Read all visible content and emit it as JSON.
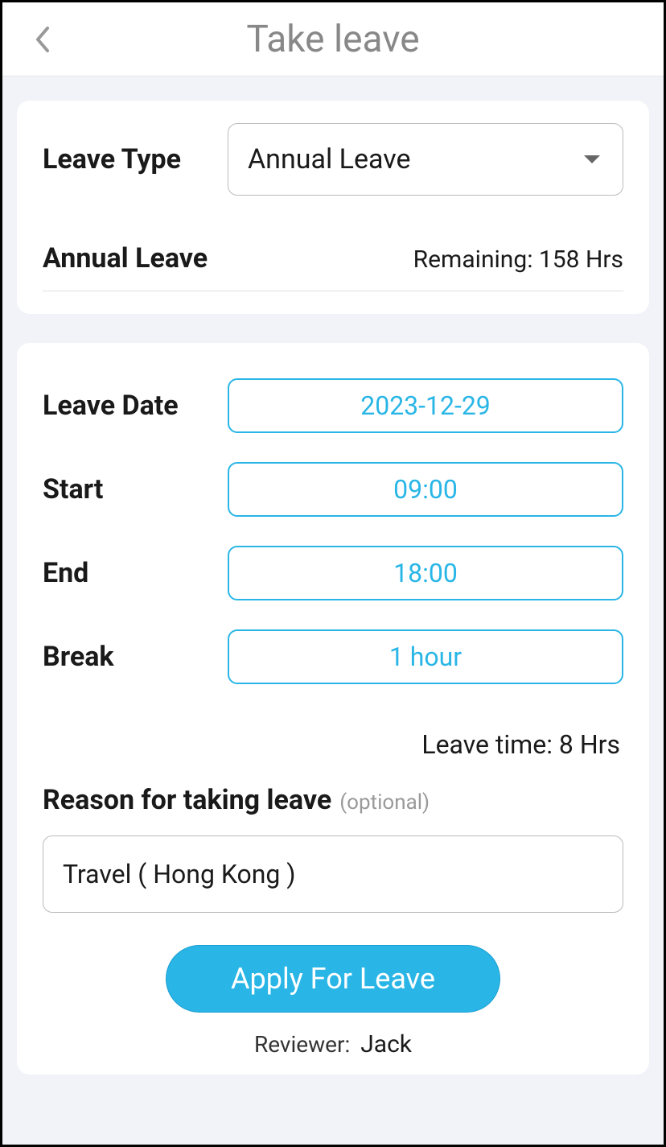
{
  "header": {
    "title": "Take leave"
  },
  "leaveType": {
    "label": "Leave Type",
    "selected": "Annual Leave"
  },
  "balance": {
    "name": "Annual Leave",
    "remaining": "Remaining: 158 Hrs"
  },
  "form": {
    "date": {
      "label": "Leave Date",
      "value": "2023-12-29"
    },
    "start": {
      "label": "Start",
      "value": "09:00"
    },
    "end": {
      "label": "End",
      "value": "18:00"
    },
    "break": {
      "label": "Break",
      "value": "1 hour"
    },
    "leaveTime": "Leave time: 8 Hrs",
    "reason": {
      "label": "Reason for taking leave",
      "optional": "(optional)",
      "value": "Travel ( Hong Kong )"
    }
  },
  "submit": {
    "button": "Apply For Leave",
    "reviewerLabel": "Reviewer:",
    "reviewerName": "Jack"
  }
}
